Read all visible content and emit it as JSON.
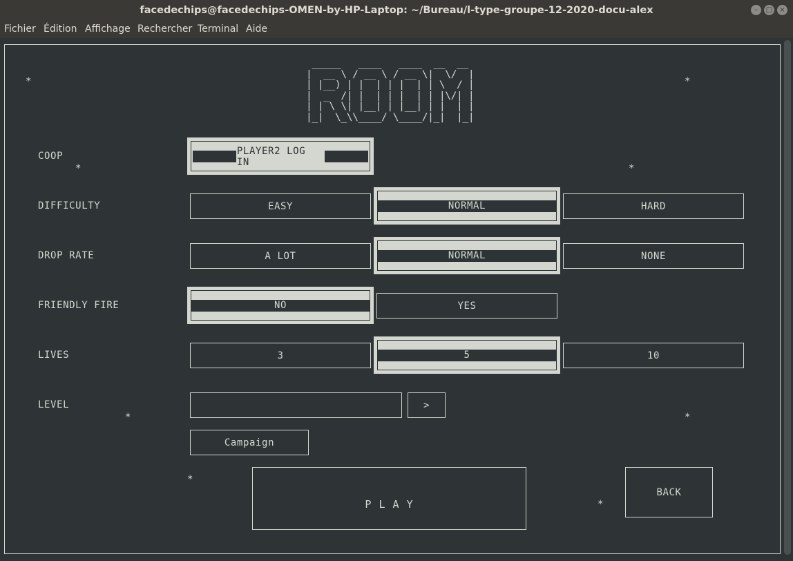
{
  "window": {
    "title": "facedechips@facedechips-OMEN-by-HP-Laptop: ~/Bureau/l-type-groupe-12-2020-docu-alex",
    "controls": [
      "minimize-icon",
      "maximize-icon",
      "close-icon"
    ]
  },
  "menu": {
    "items": [
      "Fichier",
      "Édition",
      "Affichage",
      "Rechercher",
      "Terminal",
      "Aide"
    ]
  },
  "room": {
    "ascii_title": " _____   ____   ____  __  __ \n|  __ \\ / __ \\ / __ \\|  \\/  |\n| |__) | |  | | |  | | \\  / |\n|  _  /| |  | | |  | | |\\/| |\n| | \\ \\| |__| | |__| | |  | |\n|_|  \\_\\\\____/ \\____/|_|  |_|",
    "stars": "*",
    "coop": {
      "label": "COOP",
      "button": "PLAYER2 LOG IN"
    },
    "difficulty": {
      "label": "DIFFICULTY",
      "options": [
        "EASY",
        "NORMAL",
        "HARD"
      ],
      "selected": "NORMAL"
    },
    "drop_rate": {
      "label": "DROP RATE",
      "options": [
        "A LOT",
        "NORMAL",
        "NONE"
      ],
      "selected": "NORMAL"
    },
    "friendly_fire": {
      "label": "FRIENDLY FIRE",
      "options": [
        "NO",
        "YES"
      ],
      "selected": "NO"
    },
    "lives": {
      "label": "LIVES",
      "options": [
        "3",
        "5",
        "10"
      ],
      "selected": "5"
    },
    "level": {
      "label": "LEVEL",
      "value": "",
      "next_button": ">",
      "campaign_button": "Campaign"
    },
    "play_button": "P L A Y",
    "back_button": "BACK"
  }
}
